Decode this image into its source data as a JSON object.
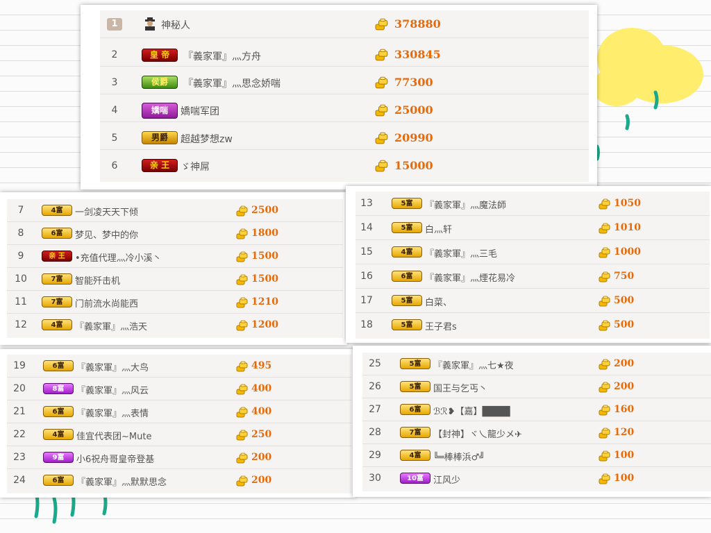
{
  "leaderboard": [
    {
      "rank": "1",
      "name": "神秘人",
      "badge": "",
      "amount": "378880"
    },
    {
      "rank": "2",
      "name": "『義家軍』灬方舟",
      "badge": "皇 帝",
      "amount": "330845"
    },
    {
      "rank": "3",
      "name": "『義家軍』灬思念娇喘",
      "badge": "侯爵",
      "amount": "77300"
    },
    {
      "rank": "4",
      "name": "嬌喘军团",
      "badge": "嬌喘",
      "amount": "25000"
    },
    {
      "rank": "5",
      "name": "超越梦想zw",
      "badge": "男爵",
      "amount": "20990"
    },
    {
      "rank": "6",
      "name": "ゞ神屌",
      "badge": "亲 王",
      "amount": "15000"
    },
    {
      "rank": "7",
      "name": "一剑凌天天下倾",
      "badge": "4富",
      "amount": "2500"
    },
    {
      "rank": "8",
      "name": "梦见、梦中的你",
      "badge": "6富",
      "amount": "1800"
    },
    {
      "rank": "9",
      "name": "•充值代理灬冷小溪丶",
      "badge": "亲 王",
      "amount": "1500"
    },
    {
      "rank": "10",
      "name": "智能歼击机",
      "badge": "7富",
      "amount": "1500"
    },
    {
      "rank": "11",
      "name": "门前流水尚能西",
      "badge": "7富",
      "amount": "1210"
    },
    {
      "rank": "12",
      "name": "『義家軍』灬浩天",
      "badge": "4富",
      "amount": "1200"
    },
    {
      "rank": "13",
      "name": "『義家軍』灬魔法師",
      "badge": "5富",
      "amount": "1050"
    },
    {
      "rank": "14",
      "name": "白灬轩",
      "badge": "5富",
      "amount": "1010"
    },
    {
      "rank": "15",
      "name": "『義家軍』灬三毛",
      "badge": "4富",
      "amount": "1000"
    },
    {
      "rank": "16",
      "name": "『義家軍』灬煙花易冷",
      "badge": "6富",
      "amount": "750"
    },
    {
      "rank": "17",
      "name": "白菜、",
      "badge": "5富",
      "amount": "500"
    },
    {
      "rank": "18",
      "name": "王子君s",
      "badge": "5富",
      "amount": "500"
    },
    {
      "rank": "19",
      "name": "『義家軍』灬大鸟",
      "badge": "6富",
      "amount": "495"
    },
    {
      "rank": "20",
      "name": "『義家軍』灬风云",
      "badge": "8富",
      "amount": "400"
    },
    {
      "rank": "21",
      "name": "『義家軍』灬表情",
      "badge": "6富",
      "amount": "400"
    },
    {
      "rank": "22",
      "name": "佳宜代表团~Mute",
      "badge": "4富",
      "amount": "250"
    },
    {
      "rank": "23",
      "name": "小6祝舟哥皇帝登基",
      "badge": "9富",
      "amount": "200"
    },
    {
      "rank": "24",
      "name": "『義家軍』灬默默思念",
      "badge": "6富",
      "amount": "200"
    },
    {
      "rank": "25",
      "name": "『義家軍』灬七★夜",
      "badge": "5富",
      "amount": "200"
    },
    {
      "rank": "26",
      "name": "国王与乞丐丶",
      "badge": "5富",
      "amount": "200"
    },
    {
      "rank": "27",
      "name": "ℬℛ❥【嘉】████",
      "badge": "6富",
      "amount": "160"
    },
    {
      "rank": "28",
      "name": "【封神】ヾ乀龍少メ✈",
      "badge": "7富",
      "amount": "120"
    },
    {
      "rank": "29",
      "name": "╚═棒棒浜♂╝",
      "badge": "4富",
      "amount": "100"
    },
    {
      "rank": "30",
      "name": "江风少",
      "badge": "10富",
      "amount": "100"
    }
  ],
  "colors": {
    "amount": "#e56a0c",
    "rank_box": "#c8b7a6",
    "cloud": "#ffee6e",
    "rain": "#1aa98a"
  }
}
